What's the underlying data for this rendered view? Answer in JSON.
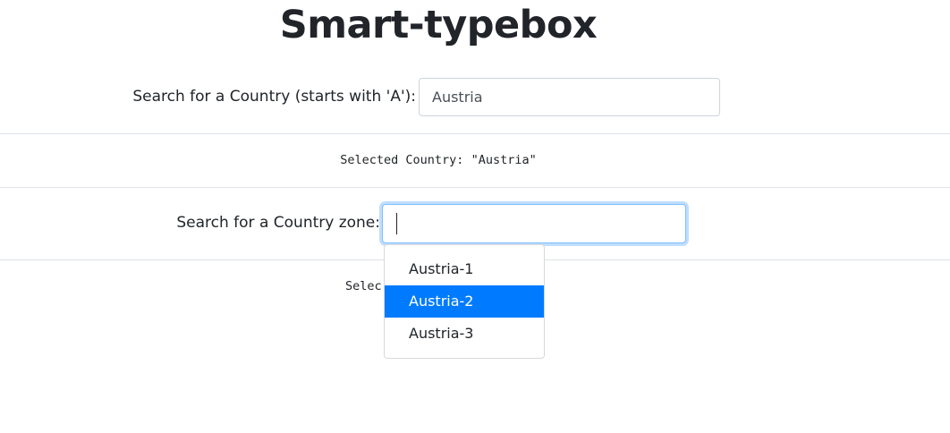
{
  "title": "Smart-typebox",
  "country_search": {
    "label": "Search for a Country (starts with 'A'):",
    "value": "Austria"
  },
  "selected_country_text": "Selected Country: \"Austria\"",
  "zone_search": {
    "label": "Search for a Country zone:",
    "value": ""
  },
  "selected_zone_text": "Selec",
  "dropdown": {
    "items": [
      {
        "label": "Austria-1",
        "highlighted": false
      },
      {
        "label": "Austria-2",
        "highlighted": true
      },
      {
        "label": "Austria-3",
        "highlighted": false
      }
    ],
    "highlight_color": "#007bff"
  }
}
